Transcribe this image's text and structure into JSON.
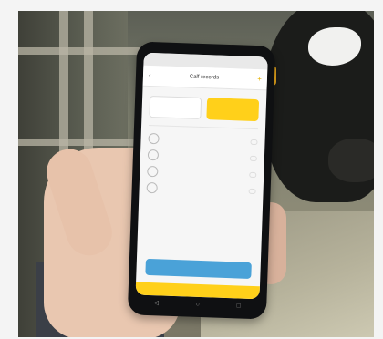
{
  "app": {
    "title": "Calf records",
    "add_icon": "add-icon",
    "back_icon": "back-icon"
  },
  "form": {
    "section_label": "",
    "options": [
      {
        "label": ""
      },
      {
        "label": "",
        "selected": true
      }
    ],
    "rows": [
      {
        "label": "",
        "value": ""
      },
      {
        "label": "",
        "value": ""
      },
      {
        "label": "",
        "value": ""
      },
      {
        "label": "",
        "value": ""
      }
    ],
    "primary_action": ""
  },
  "colors": {
    "accent_yellow": "#ffd01a",
    "button_blue": "#4aa2d8"
  },
  "nav": {
    "icons": [
      "back-nav-icon",
      "home-nav-icon",
      "recent-apps-icon"
    ]
  }
}
